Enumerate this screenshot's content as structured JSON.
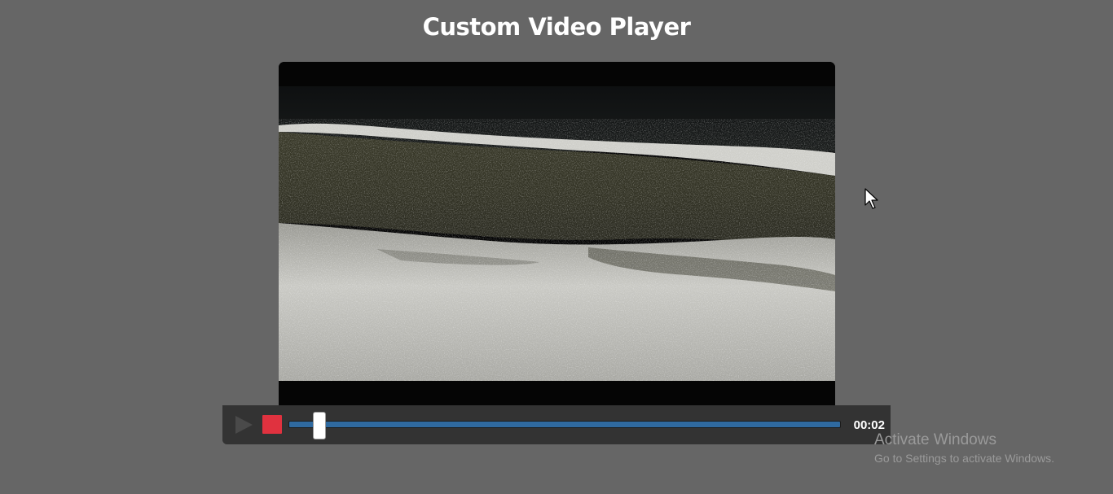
{
  "page": {
    "title": "Custom Video Player",
    "background_color": "#666666"
  },
  "video": {
    "content": "water-waves-frame"
  },
  "controls": {
    "play_icon": "play-icon",
    "stop_icon": "stop-icon",
    "stop_color": "#e0323f",
    "progress_color": "#2f6aa0",
    "progress_fraction": 0.045,
    "current_time": "00:02"
  },
  "watermark": {
    "title": "Activate Windows",
    "subtitle": "Go to Settings to activate Windows."
  },
  "cursor": {
    "icon": "arrow-pointer-icon"
  }
}
